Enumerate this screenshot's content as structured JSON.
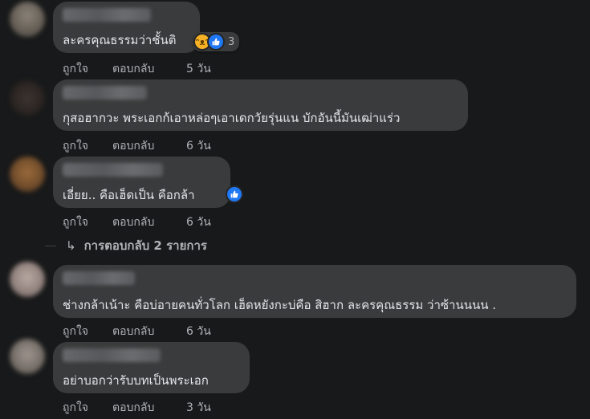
{
  "comments": [
    {
      "text": "ละครคุณธรรมว่าชั้นติ",
      "actions": {
        "like": "ถูกใจ",
        "reply": "ตอบกลับ",
        "time": "5 วัน"
      },
      "reactions": {
        "types": [
          "haha-icon",
          "like-icon"
        ],
        "count": "3"
      }
    },
    {
      "text": "กุสอฮากวะ พระเอกก้เอาหล่อๆเอาเดกวัยรุ่นแน บักอันนี้มันเฒ่าแร่ว",
      "actions": {
        "like": "ถูกใจ",
        "reply": "ตอบกลับ",
        "time": "6 วัน"
      }
    },
    {
      "text": "เอี่ยย.. คือเฮ็ดเป็น คือกล้า",
      "actions": {
        "like": "ถูกใจ",
        "reply": "ตอบกลับ",
        "time": "6 วัน"
      },
      "reactions": {
        "types": [
          "like-icon"
        ],
        "count": ""
      }
    },
    {
      "text": "ช่างกล้าเน้าะ คือบ่อายคนทั่วโลก เฮ็ดหยังกะบ่คือ สิฮาก ละครคุณธรรม ว่าซ้านนนน .",
      "actions": {
        "like": "ถูกใจ",
        "reply": "ตอบกลับ",
        "time": "6 วัน"
      }
    },
    {
      "text": "อย่าบอกว่ารับบทเป็นพระเอก",
      "actions": {
        "like": "ถูกใจ",
        "reply": "ตอบกลับ",
        "time": "3 วัน"
      }
    }
  ],
  "replies_link": "การตอบกลับ 2 รายการ",
  "colors": {
    "background": "#18191a",
    "bubble": "#3a3b3c",
    "text": "#e4e6eb",
    "muted": "#b0b3b8",
    "like_blue": "#2078f4",
    "haha_yellow": "#f7b125"
  }
}
